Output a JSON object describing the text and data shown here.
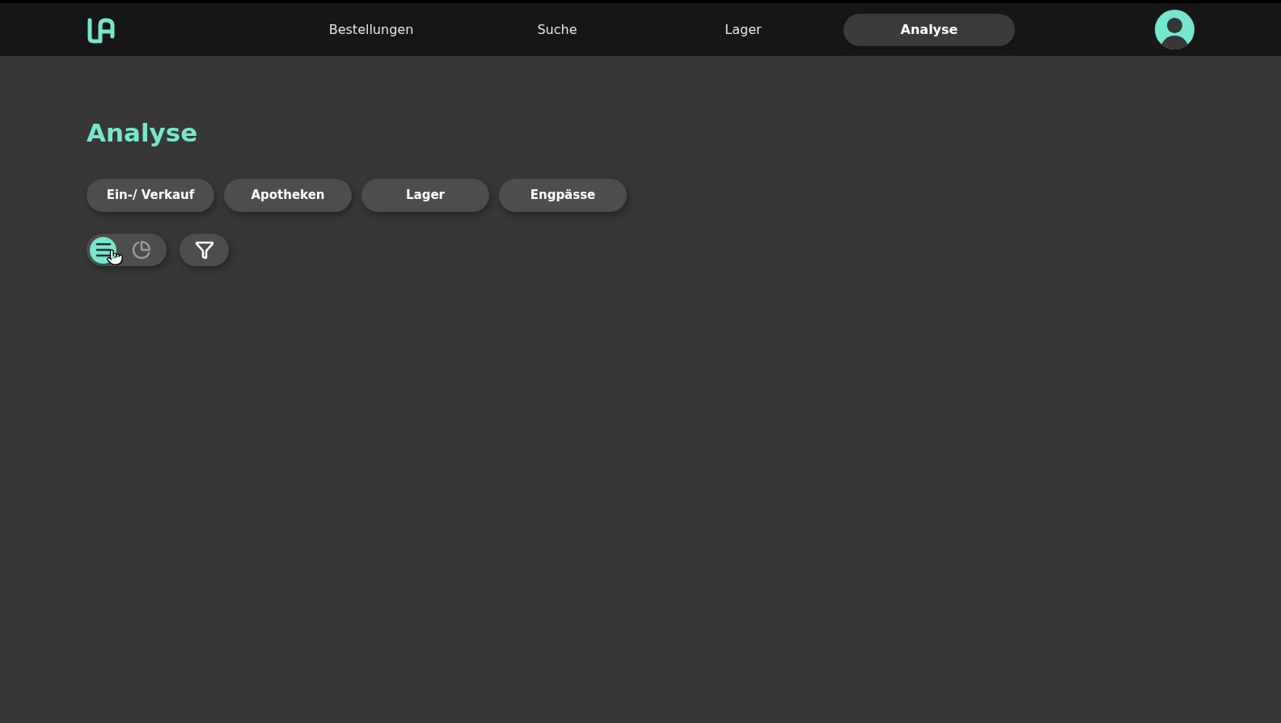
{
  "nav": [
    {
      "label": "Bestellungen",
      "selected": false
    },
    {
      "label": "Suche",
      "selected": false
    },
    {
      "label": "Lager",
      "selected": false
    },
    {
      "label": "Analyse",
      "selected": true
    }
  ],
  "page_title": "Analyse",
  "tabs": [
    {
      "label": "Ein-/ Verkauf",
      "selected": false
    },
    {
      "label": "Apotheken",
      "selected": false
    },
    {
      "label": "Lager",
      "selected": false
    },
    {
      "label": "Engpässe",
      "selected": false
    }
  ],
  "view_toggle": [
    {
      "kind": "list",
      "selected": true
    },
    {
      "kind": "pie",
      "selected": false
    }
  ]
}
